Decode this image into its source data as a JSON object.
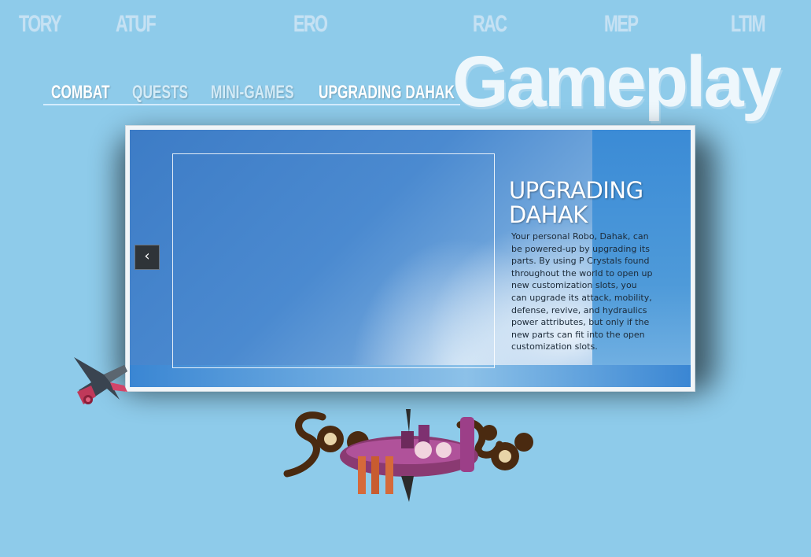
{
  "top_nav": {
    "items": [
      {
        "label": "TORY"
      },
      {
        "label": "ATUF"
      },
      {
        "label": "ERO"
      },
      {
        "label": "RAC"
      },
      {
        "label": "MEP"
      },
      {
        "label": "LTIM"
      }
    ]
  },
  "section": {
    "title": "Gameplay",
    "tabs": [
      {
        "label": "COMBAT"
      },
      {
        "label": "QUESTS"
      },
      {
        "label": "MINI-GAMES"
      },
      {
        "label": "UPGRADING DAHAK"
      }
    ],
    "active_tab": "UPGRADING DAHAK"
  },
  "slide": {
    "heading_line1": "UPGRADING",
    "heading_line2": "DAHAK",
    "body": "Your personal Robo, Dahak, can be powered-up by upgrading its parts. By using P Crystals found throughout the world to open up new customization slots, you can upgrade its attack, mobility, defense, revive, and hydraulics power attributes, but only if the new parts can fit into the open customization slots.",
    "prev_icon": "chevron-left-icon"
  },
  "colors": {
    "background": "#8ecbea",
    "panel_blue": "#3d7cc6",
    "nav_text": "#cfe6f5"
  }
}
